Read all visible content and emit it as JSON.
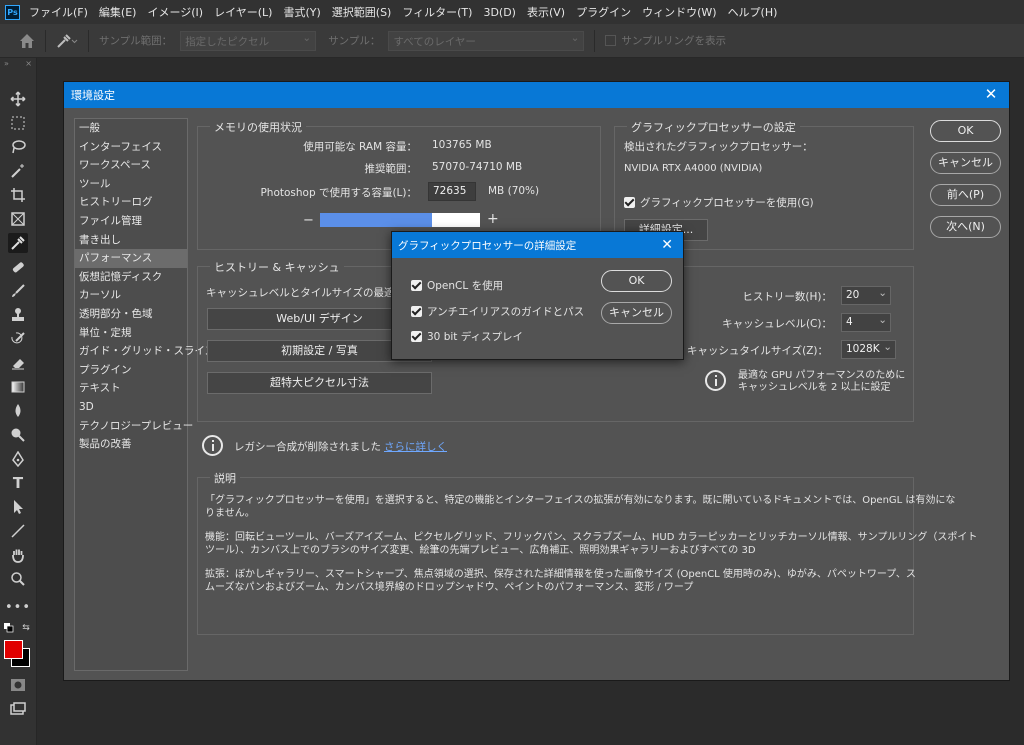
{
  "app": {
    "logo": "Ps"
  },
  "menu": [
    "ファイル(F)",
    "編集(E)",
    "イメージ(I)",
    "レイヤー(L)",
    "書式(Y)",
    "選択範囲(S)",
    "フィルター(T)",
    "3D(D)",
    "表示(V)",
    "プラグイン",
    "ウィンドウ(W)",
    "ヘルプ(H)"
  ],
  "options": {
    "sample_size_label": "サンプル範囲：",
    "sample_size_value": "指定したピクセル",
    "sample_label": "サンプル：",
    "sample_value": "すべてのレイヤー",
    "sampling_ring_label": "サンプルリングを表示"
  },
  "dialog": {
    "title": "環境設定",
    "categories": [
      "一般",
      "インターフェイス",
      "ワークスペース",
      "ツール",
      "ヒストリーログ",
      "ファイル管理",
      "書き出し",
      "パフォーマンス",
      "仮想記憶ディスク",
      "カーソル",
      "透明部分・色域",
      "単位・定規",
      "ガイド・グリッド・スライス",
      "プラグイン",
      "テキスト",
      "3D",
      "テクノロジープレビュー",
      "製品の改善"
    ],
    "active_category": "パフォーマンス",
    "buttons": {
      "ok": "OK",
      "cancel": "キャンセル",
      "prev": "前へ(P)",
      "next": "次へ(N)"
    },
    "memory": {
      "title": "メモリの使用状況",
      "available_label": "使用可能な RAM 容量：",
      "available_value": "103765 MB",
      "ideal_label": "推奨範囲：",
      "ideal_value": "57070-74710 MB",
      "use_label": "Photoshop で使用する容量(L)：",
      "use_value": "72635",
      "use_unit": "MB (70%)",
      "minus": "−",
      "plus": "+",
      "usage_fraction": 0.7
    },
    "gpu": {
      "title": "グラフィックプロセッサーの設定",
      "detected_label": "検出されたグラフィックプロセッサー：",
      "detected_value": "NVIDIA RTX A4000 (NVIDIA)",
      "use_gpu_label": "グラフィックプロセッサーを使用(G)",
      "advanced_button": "詳細設定..."
    },
    "history": {
      "title": "ヒストリー & キャッシュ",
      "intro": "キャッシュレベルとタイルサイズの最適化",
      "presets": [
        "Web/UI デザイン",
        "初期設定 / 写真",
        "超特大ピクセル寸法"
      ],
      "history_states_label": "ヒストリー数(H)：",
      "history_states_value": "20",
      "cache_levels_label": "キャッシュレベル(C)：",
      "cache_levels_value": "4",
      "cache_tile_label": "キャッシュタイルサイズ(Z)：",
      "cache_tile_value": "1028K",
      "hint_line1": "最適な GPU パフォーマンスのために",
      "hint_line2": "キャッシュレベルを 2 以上に設定"
    },
    "legacy": {
      "text": "レガシー合成が削除されました",
      "link": "さらに詳しく"
    },
    "description": {
      "title": "説明",
      "line1": "「グラフィックプロセッサーを使用」を選択すると、特定の機能とインターフェイスの拡張が有効になります。既に開いているドキュメントでは、OpenGL は有効にな",
      "line2": "りません。",
      "line3": "機能：回転ビューツール、バーズアイズーム、ピクセルグリッド、フリックパン、スクラブズーム、HUD カラーピッカーとリッチカーソル情報、サンプルリング（スポイト",
      "line4": "ツール）、カンバス上でのブラシのサイズ変更、絵筆の先端プレビュー、広角補正、照明効果ギャラリーおよびすべての 3D",
      "line5": "拡張：ぼかしギャラリー、スマートシャープ、焦点領域の選択、保存された詳細情報を使った画像サイズ (OpenCL 使用時のみ)、ゆがみ、パペットワープ、ス",
      "line6": "ムーズなパンおよびズーム、カンバス境界線のドロップシャドウ、ペイントのパフォーマンス、変形 / ワープ"
    }
  },
  "advanced": {
    "title": "グラフィックプロセッサーの詳細設定",
    "opencl_label": "OpenCL を使用",
    "antialias_label": "アンチエイリアスのガイドとパス",
    "display30_label": "30 bit ディスプレイ",
    "ok": "OK",
    "cancel": "キャンセル"
  },
  "colors": {
    "accent": "#0878d6",
    "foreground": "#e00000",
    "background": "#000000",
    "bar_fill": "#5b8fe8"
  }
}
